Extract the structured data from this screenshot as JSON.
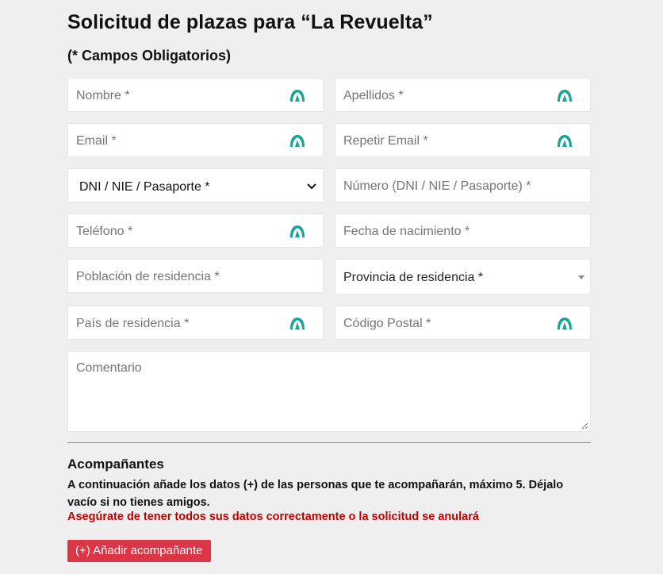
{
  "form": {
    "title": "Solicitud de plazas para “La Revuelta”",
    "required_note": "(* Campos Obligatorios)",
    "fields": {
      "nombre": "Nombre *",
      "apellidos": "Apellidos *",
      "email": "Email *",
      "repetir_email": "Repetir Email *",
      "doc_type_selected": "DNI / NIE / Pasaporte *",
      "numero": "Número (DNI / NIE / Pasaporte) *",
      "telefono": "Teléfono *",
      "fecha_nacimiento": "Fecha de nacimiento *",
      "poblacion": "Población de residencia *",
      "provincia_selected": "Provincia de residencia *",
      "pais": "País de residencia *",
      "codigo_postal": "Código Postal *",
      "comentario": "Comentario"
    },
    "icon_color": "#1aa39a"
  },
  "acompanantes": {
    "title": "Acompañantes",
    "description": "A continuación añade los datos (+) de las personas que te acompañarán, máximo 5. Déjalo vacío si no tienes amigos.",
    "warning": "Asegúrate de tener todos sus datos correctamente o la solicitud se anulará",
    "warning_color": "#c00000",
    "add_button": "(+) Añadir acompañante",
    "add_button_color": "#dc3545"
  }
}
